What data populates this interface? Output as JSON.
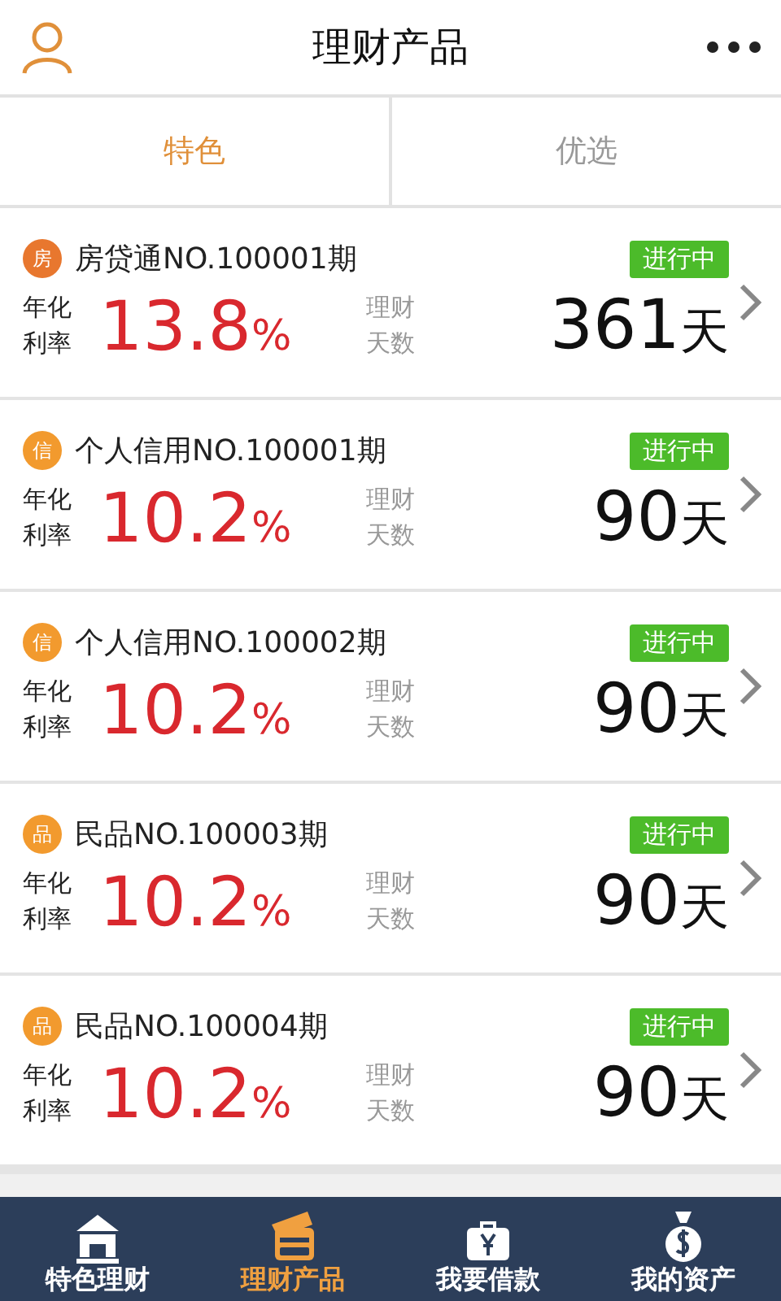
{
  "header": {
    "title": "理财产品"
  },
  "tabs": [
    {
      "label": "特色",
      "selected": true
    },
    {
      "label": "优选",
      "selected": false
    }
  ],
  "products": [
    {
      "badge": "房",
      "color": "#e8772e",
      "name": "房贷通NO.100001期",
      "status": "进行中",
      "rate_label": [
        "年化",
        "利率"
      ],
      "rate": "13.8",
      "unit": "%",
      "term_label": [
        "理财",
        "天数"
      ],
      "days": "361",
      "day_unit": "天"
    },
    {
      "badge": "信",
      "color": "#f29a2e",
      "name": "个人信用NO.100001期",
      "status": "进行中",
      "rate_label": [
        "年化",
        "利率"
      ],
      "rate": "10.2",
      "unit": "%",
      "term_label": [
        "理财",
        "天数"
      ],
      "days": "90",
      "day_unit": "天"
    },
    {
      "badge": "信",
      "color": "#f29a2e",
      "name": "个人信用NO.100002期",
      "status": "进行中",
      "rate_label": [
        "年化",
        "利率"
      ],
      "rate": "10.2",
      "unit": "%",
      "term_label": [
        "理财",
        "天数"
      ],
      "days": "90",
      "day_unit": "天"
    },
    {
      "badge": "品",
      "color": "#f29a2e",
      "name": "民品NO.100003期",
      "status": "进行中",
      "rate_label": [
        "年化",
        "利率"
      ],
      "rate": "10.2",
      "unit": "%",
      "term_label": [
        "理财",
        "天数"
      ],
      "days": "90",
      "day_unit": "天"
    },
    {
      "badge": "品",
      "color": "#f29a2e",
      "name": "民品NO.100004期",
      "status": "进行中",
      "rate_label": [
        "年化",
        "利率"
      ],
      "rate": "10.2",
      "unit": "%",
      "term_label": [
        "理财",
        "天数"
      ],
      "days": "90",
      "day_unit": "天"
    }
  ],
  "nav": [
    {
      "label": "特色理财",
      "kind": "house",
      "selected": false
    },
    {
      "label": "理财产品",
      "kind": "cards",
      "selected": true
    },
    {
      "label": "我要借款",
      "kind": "briefcase",
      "selected": false
    },
    {
      "label": "我的资产",
      "kind": "moneybag",
      "selected": false
    }
  ]
}
